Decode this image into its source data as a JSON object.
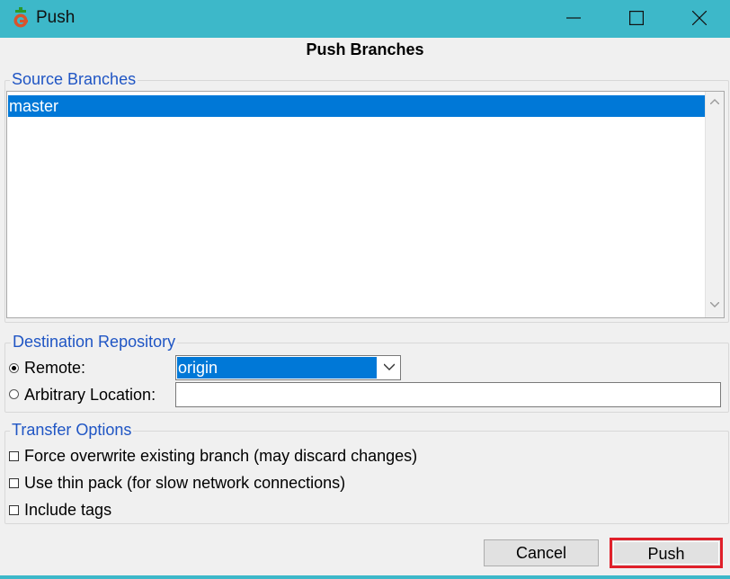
{
  "window": {
    "title": "Push",
    "icon": "git-push-app-icon",
    "controls": [
      "minimize-icon",
      "maximize-icon",
      "close-icon"
    ],
    "accent_color": "#3db8c9"
  },
  "dialog": {
    "heading": "Push Branches"
  },
  "source_branches": {
    "legend": "Source Branches",
    "items": [
      {
        "label": "master",
        "selected": true
      }
    ],
    "selection_color": "#0078d7"
  },
  "destination": {
    "legend": "Destination Repository",
    "remote_label": "Remote:",
    "remote_selected": true,
    "remote_value": "origin",
    "arbitrary_label": "Arbitrary Location:",
    "arbitrary_selected": false,
    "arbitrary_value": ""
  },
  "transfer_options": {
    "legend": "Transfer Options",
    "options": [
      {
        "label": "Force overwrite existing branch (may discard changes)",
        "checked": false
      },
      {
        "label": "Use thin pack (for slow network connections)",
        "checked": false
      },
      {
        "label": "Include tags",
        "checked": false
      }
    ]
  },
  "buttons": {
    "cancel": "Cancel",
    "push": "Push",
    "highlight_color": "#e0202a"
  }
}
